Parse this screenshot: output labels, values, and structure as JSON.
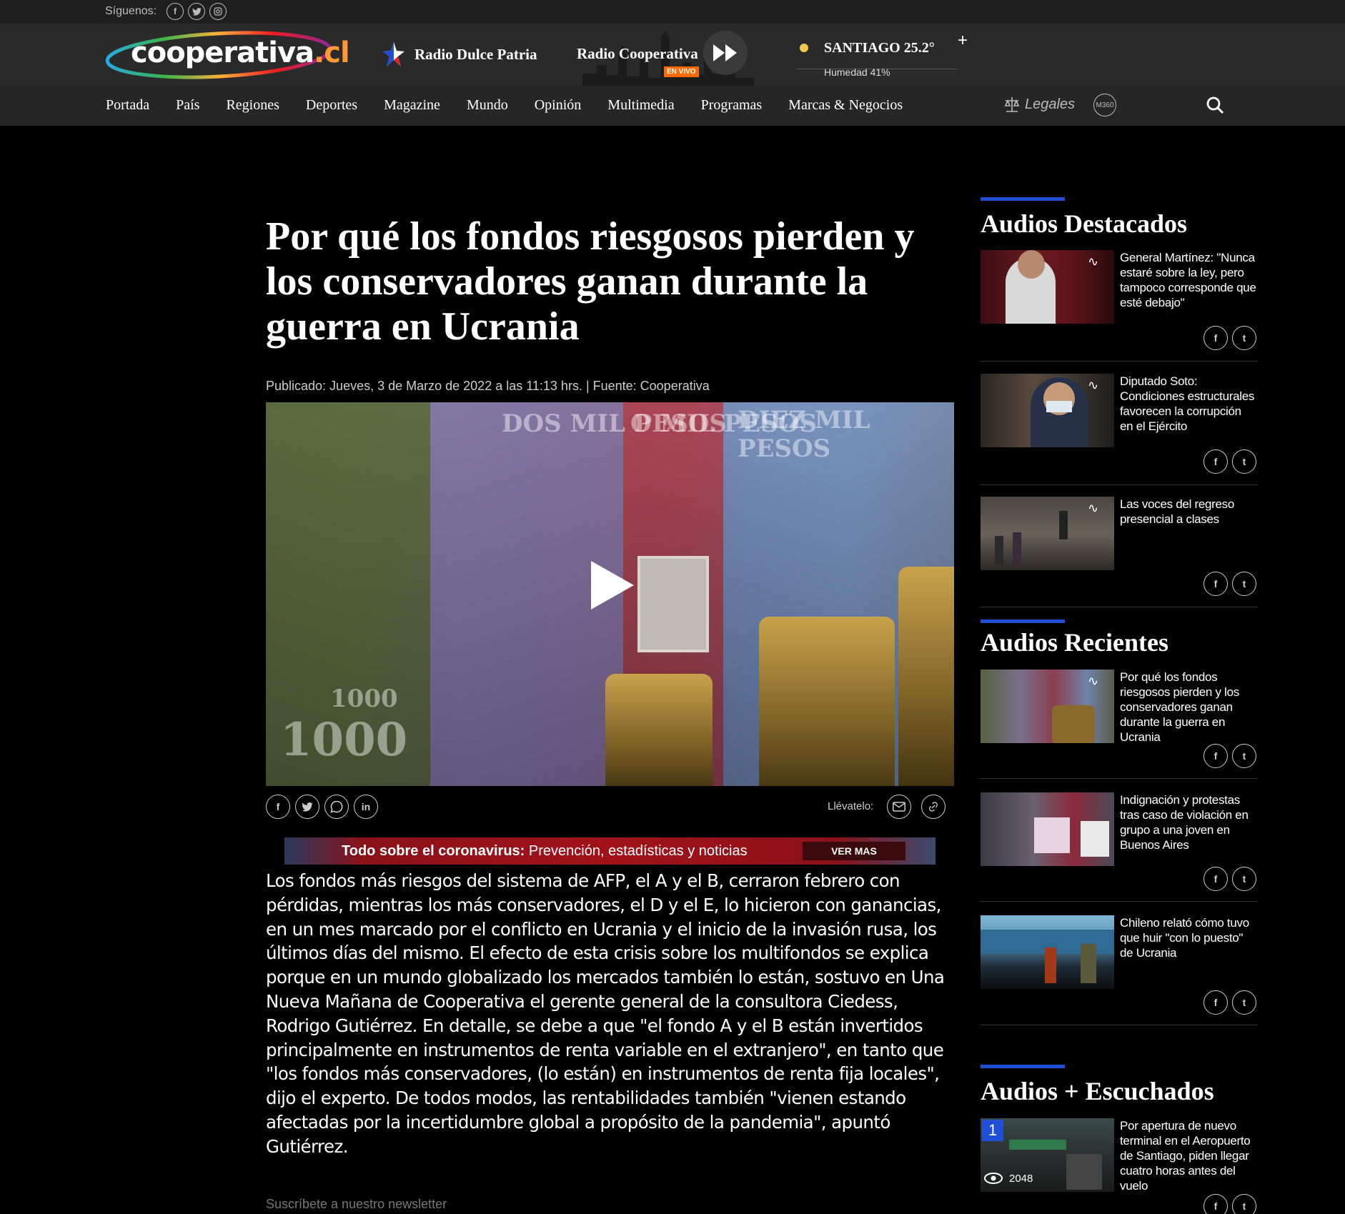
{
  "topbar": {
    "follow_label": "Síguenos:"
  },
  "header": {
    "logo_text": "cooperativa",
    "logo_suffix": ".cl",
    "radio_dulce_patria": "Radio Dulce Patria",
    "radio_cooperativa": "Radio Cooperativa",
    "en_vivo": "EN VIVO",
    "weather": {
      "city_temp": "SANTIAGO 25.2°",
      "humidity": "Humedad  41%"
    },
    "weather_more": "+"
  },
  "nav": {
    "items": [
      "Portada",
      "País",
      "Regiones",
      "Deportes",
      "Magazine",
      "Mundo",
      "Opinión",
      "Multimedia",
      "Programas",
      "Marcas & Negocios"
    ],
    "legales": "Legales",
    "m360": "M360"
  },
  "article": {
    "headline": "Por qué los fondos riesgosos pierden y los conservadores ganan durante la guerra en Ucrania",
    "meta": "Publicado: Jueves, 3 de Marzo de 2022 a las 11:13 hrs. | Fuente: Cooperativa",
    "video_texts": [
      "DOS MIL PESOS",
      "O MIL PESOS",
      "DIEZ MIL PESOS",
      "1000",
      "1000"
    ],
    "share_label": "Llévatelo:",
    "banner": {
      "bold": "Todo sobre el coronavirus:",
      "rest": " Prevención, estadísticas y noticias",
      "button": "VER MAS"
    },
    "body": "Los fondos más riesgos del sistema de AFP, el A y el B, cerraron febrero con pérdidas, mientras los más conservadores, el D y el E, lo hicieron con ganancias, en un mes marcado por el conflicto en Ucrania y el inicio de la invasión rusa, los últimos días del mismo. El efecto de esta crisis sobre los multifondos se explica porque en un mundo globalizado los mercados también lo están, sostuvo en Una Nueva Mañana de Cooperativa el gerente general de la consultora Ciedess, Rodrigo Gutiérrez. En detalle, se debe a que \"el fondo A y el B están invertidos principalmente en instrumentos de renta variable en el extranjero\", en tanto que \"los fondos más conservadores, (lo están) en instrumentos de renta fija locales\", dijo el experto. De todos modos, las rentabilidades también \"vienen estando afectadas por la incertidumbre global a propósito de la pandemia\", apuntó Gutiérrez.",
    "newsletter": "Suscríbete a nuestro newsletter"
  },
  "sidebar": {
    "destacados_title": "Audios Destacados",
    "destacados": [
      {
        "title": "General Martínez: \"Nunca estaré sobre la ley, pero tampoco corresponde que esté debajo\""
      },
      {
        "title": "Diputado Soto: Condiciones estructurales favorecen la corrupción en el Ejército"
      },
      {
        "title": "Las voces del regreso presencial a clases"
      }
    ],
    "recientes_title": "Audios Recientes",
    "recientes": [
      {
        "title": "Por qué los fondos riesgosos pierden y los conservadores ganan durante la guerra en Ucrania"
      },
      {
        "title": "Indignación y protestas tras caso de violación en grupo a una joven en Buenos Aires"
      },
      {
        "title": "Chileno relató cómo tuvo que huir \"con lo puesto\" de Ucrania"
      }
    ],
    "escuchados_title": "Audios + Escuchados",
    "escuchados": [
      {
        "rank": "1",
        "views": "2048",
        "title": "Por apertura de nuevo terminal en el Aeropuerto de Santiago, piden llegar cuatro horas antes del vuelo"
      }
    ]
  }
}
